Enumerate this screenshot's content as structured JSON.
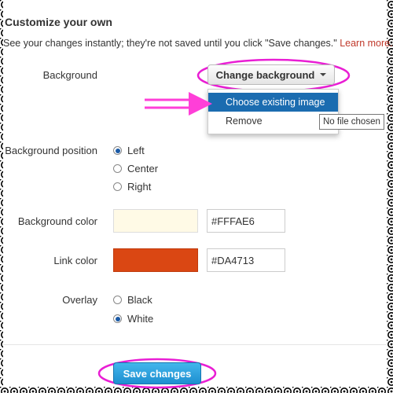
{
  "header": {
    "title": "Customize your own",
    "note": "See your changes instantly; they're not saved until you click \"Save changes.\"",
    "learn_more": "Learn more."
  },
  "background": {
    "label": "Background",
    "button_label": "Change background",
    "menu": {
      "items": [
        "Choose existing image",
        "Remove"
      ]
    },
    "tooltip": "No file chosen"
  },
  "background_position": {
    "label": "Background position",
    "options": [
      "Left",
      "Center",
      "Right"
    ],
    "selected": "Left"
  },
  "background_color": {
    "label": "Background color",
    "value": "#FFFAE6",
    "swatch": "#FFFAE6"
  },
  "link_color": {
    "label": "Link color",
    "value": "#DA4713",
    "swatch": "#DA4713"
  },
  "overlay": {
    "label": "Overlay",
    "options": [
      "Black",
      "White"
    ],
    "selected": "White"
  },
  "footer": {
    "save_label": "Save changes"
  },
  "annotations": {
    "highlight_color": "#e91ed4",
    "arrow_color": "#ff3fd8"
  }
}
